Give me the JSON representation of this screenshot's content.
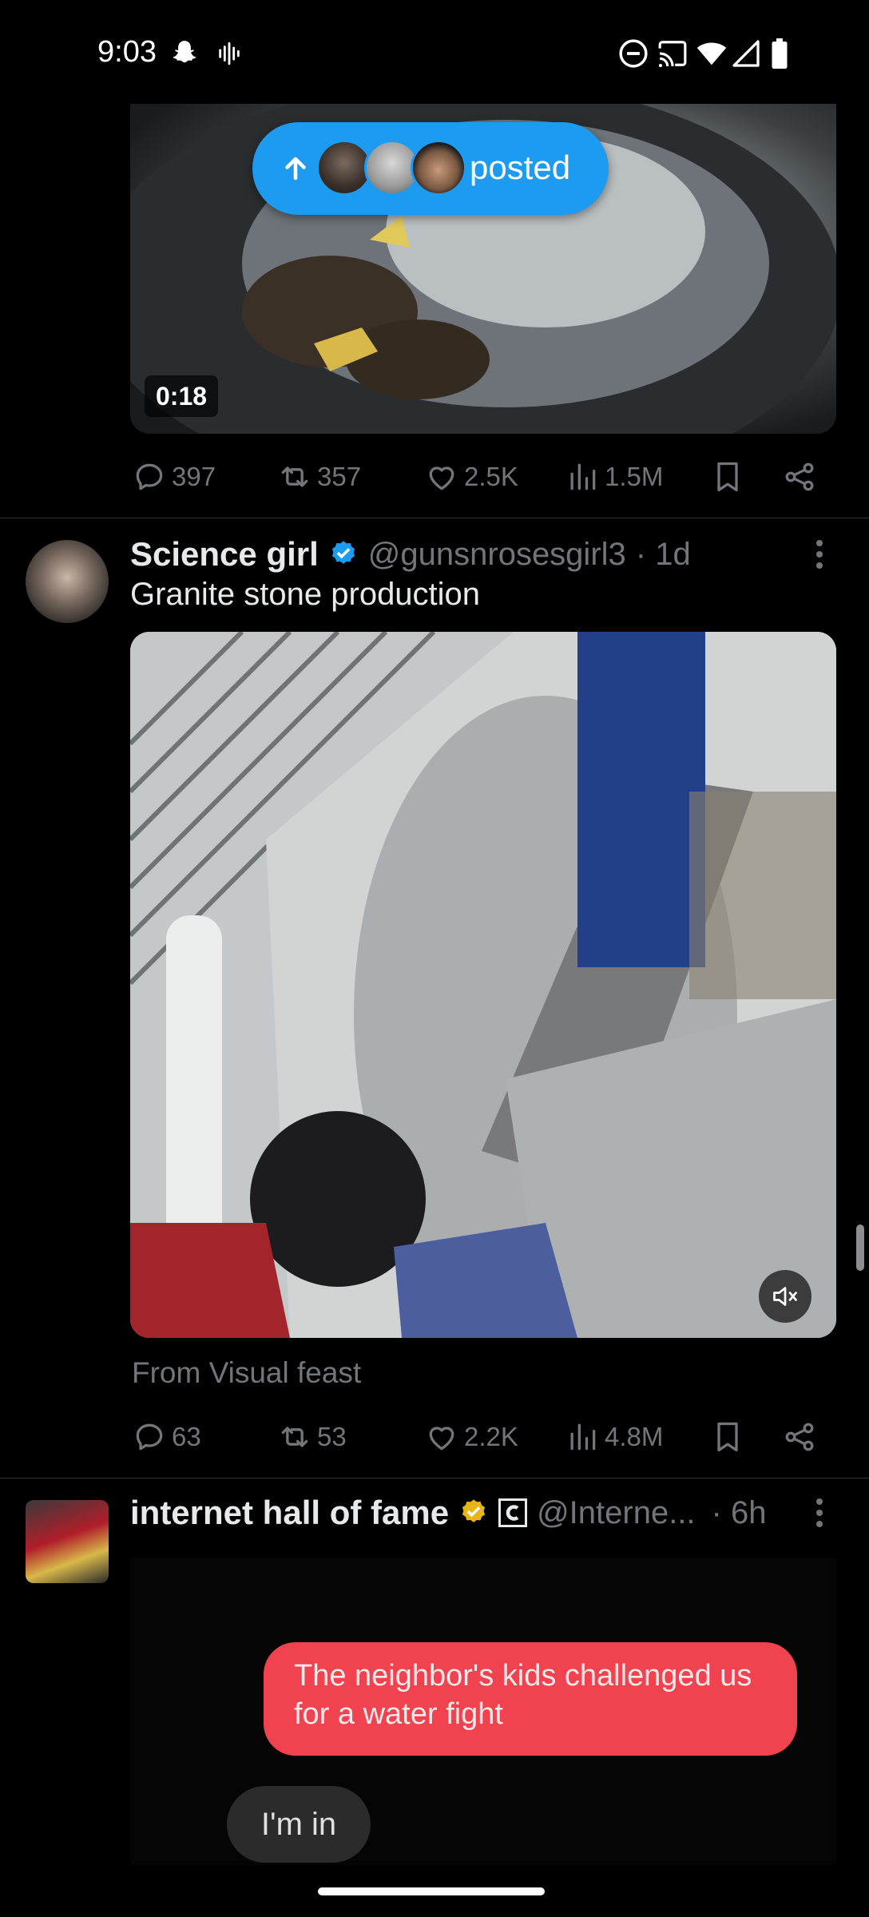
{
  "status_bar": {
    "time": "9:03",
    "icons": [
      "snapchat-icon",
      "audio-wave-icon",
      "dnd-icon",
      "cast-icon",
      "wifi-icon",
      "signal-icon",
      "battery-icon"
    ]
  },
  "tweet1": {
    "video_duration": "0:18",
    "posted_pill": {
      "label": "posted"
    },
    "actions": {
      "replies": "397",
      "reposts": "357",
      "likes": "2.5K",
      "views": "1.5M"
    }
  },
  "tweet2": {
    "display_name": "Science girl",
    "handle": "@gunsnrosesgirl3",
    "time": "· 1d",
    "text": "Granite stone production",
    "source": "From Visual feast",
    "actions": {
      "replies": "63",
      "reposts": "53",
      "likes": "2.2K",
      "views": "4.8M"
    }
  },
  "tweet3": {
    "display_name": "internet hall of fame",
    "handle": "@Interne...",
    "time": "· 6h",
    "media_text": {
      "red_bubble": "The neighbor's kids challenged us for a water fight",
      "gray_bubble": "I'm in"
    }
  },
  "colors": {
    "accent": "#1d9bf0",
    "muted": "#71767b",
    "gold_badge": "#e8b516"
  }
}
